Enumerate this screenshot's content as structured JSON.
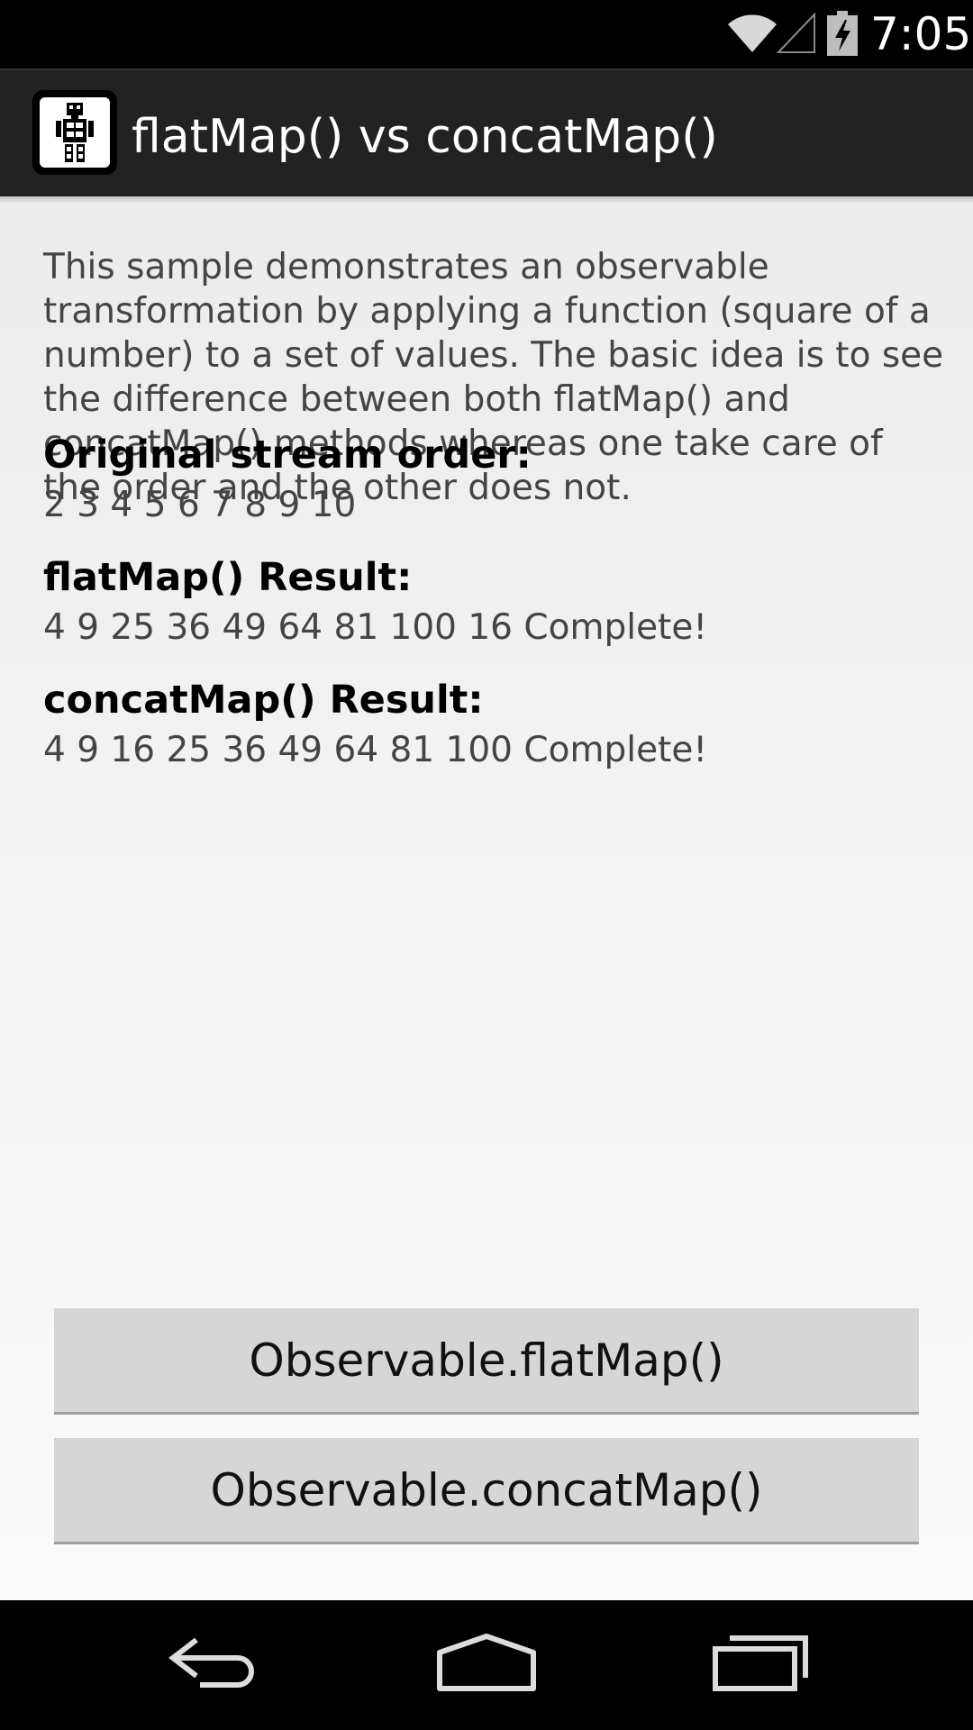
{
  "status_bar": {
    "time": "7:05",
    "icons": [
      "wifi-icon",
      "cell-signal-icon",
      "battery-charging-icon"
    ]
  },
  "action_bar": {
    "title": "flatMap() vs concatMap()",
    "app_icon": "robot-icon"
  },
  "content": {
    "description": "This sample demonstrates an observable transformation by applying a function (square of a number) to a set of values. The basic idea is to see the difference between both flatMap() and concatMap() methods whereas one take care of the order and the other does not.",
    "original_heading": "Original stream order:",
    "original_value": "2 3 4 5 6 7 8 9 10",
    "flatmap_heading": "flatMap() Result:",
    "flatmap_value": "4 9 25 36 49 64 81 100 16 Complete!",
    "concatmap_heading": "concatMap() Result:",
    "concatmap_value": "4 9 16 25 36 49 64 81 100 Complete!"
  },
  "buttons": {
    "flatmap_label": "Observable.flatMap()",
    "concatmap_label": "Observable.concatMap()"
  },
  "nav_bar": {
    "icons": [
      "back-icon",
      "home-icon",
      "recents-icon"
    ]
  },
  "colors": {
    "status_bar": "#000000",
    "action_bar": "#222222",
    "button": "#d6d6d6",
    "background": "#f2f2f2"
  }
}
